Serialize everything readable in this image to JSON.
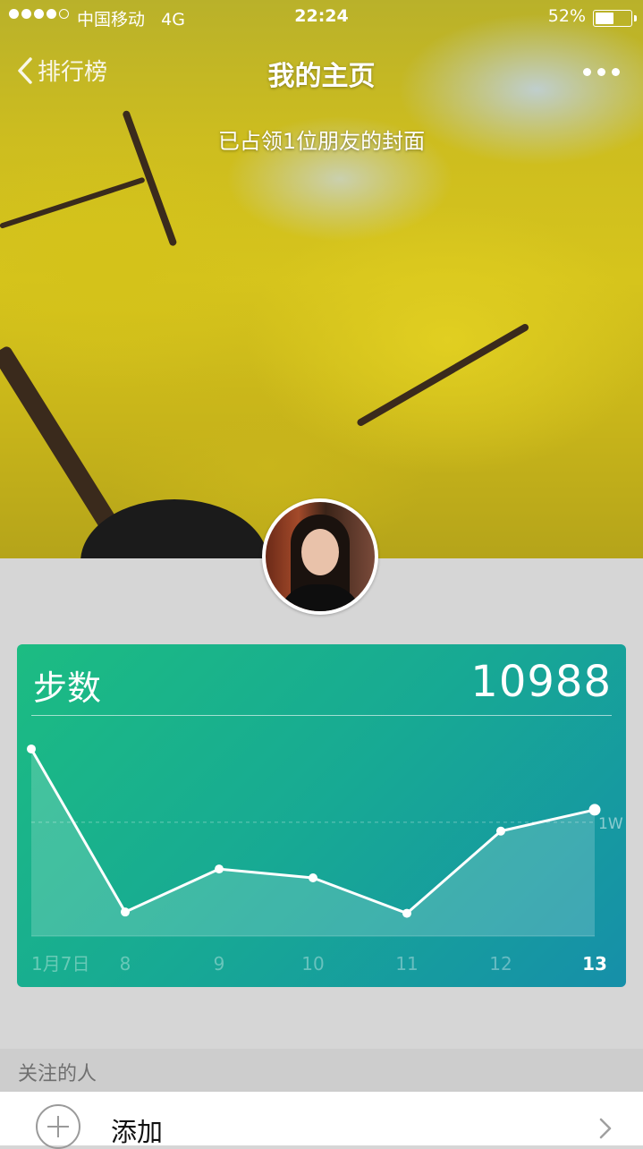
{
  "status_bar": {
    "carrier": "中国移动",
    "network": "4G",
    "time": "22:24",
    "battery_percent": "52%",
    "battery_level": 0.52,
    "signal_bars": 4
  },
  "nav": {
    "back_label": "排行榜",
    "title": "我的主页"
  },
  "cover": {
    "subtitle": "已占领1位朋友的封面"
  },
  "steps_card": {
    "label": "步数",
    "value": "10988"
  },
  "chart_data": {
    "type": "line",
    "categories": [
      "1月7日",
      "8",
      "9",
      "10",
      "11",
      "12",
      "13"
    ],
    "values": [
      15800,
      2900,
      6300,
      5600,
      2800,
      9300,
      10988
    ],
    "reference_line": {
      "value": 10000,
      "label": "1W"
    },
    "ylim": [
      1000,
      17000
    ],
    "highlight_category": "13",
    "grid": false
  },
  "follow_section": {
    "title": "关注的人",
    "add_label": "添加"
  },
  "colors": {
    "card_gradient_start": "#1cbc82",
    "card_gradient_end": "#168fa9",
    "page_background": "#d6d6d6"
  }
}
